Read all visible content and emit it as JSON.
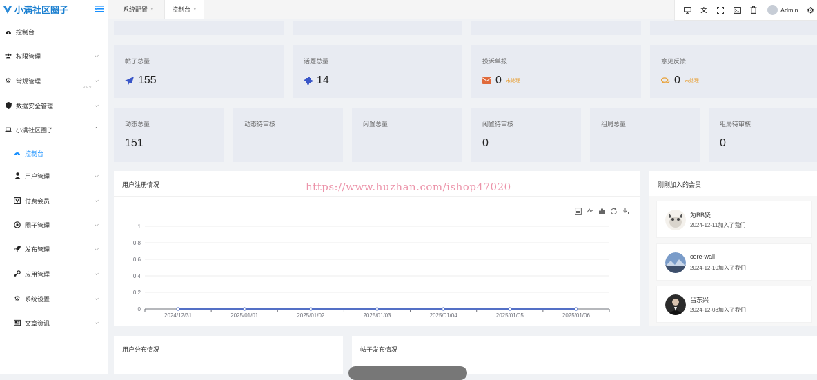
{
  "brand": {
    "title": "小满社区圈子"
  },
  "sidebar": {
    "items": [
      {
        "label": "控制台",
        "icon": "dashboard-icon"
      },
      {
        "label": "权限管理",
        "icon": "users-icon"
      },
      {
        "label": "常规管理",
        "icon": "gears-icon"
      },
      {
        "label": "数据安全管理",
        "icon": "shield-icon"
      },
      {
        "label": "小满社区圈子",
        "icon": "laptop-icon"
      },
      {
        "label": "控制台",
        "icon": "dashboard-icon"
      },
      {
        "label": "用户管理",
        "icon": "user-icon"
      },
      {
        "label": "付费会员",
        "icon": "vip-card-icon"
      },
      {
        "label": "圈子管理",
        "icon": "circle-icon"
      },
      {
        "label": "发布管理",
        "icon": "rocket-icon"
      },
      {
        "label": "应用管理",
        "icon": "steam-icon"
      },
      {
        "label": "系统设置",
        "icon": "gears-icon"
      },
      {
        "label": "文章资讯",
        "icon": "newspaper-icon"
      }
    ]
  },
  "tabs": [
    {
      "label": "系统配置"
    },
    {
      "label": "控制台"
    }
  ],
  "toolbar": {
    "user": "Admin"
  },
  "stats_row1": [
    {
      "title": "帖子总量",
      "value": "155",
      "icon": "paper-plane-icon",
      "color": "#3a56c8"
    },
    {
      "title": "话题总量",
      "value": "14",
      "icon": "puzzle-icon",
      "color": "#3a56c8"
    },
    {
      "title": "投诉单报",
      "value": "0",
      "icon": "envelope-icon",
      "color": "#e06a3b",
      "badge": "未处理"
    },
    {
      "title": "意见反馈",
      "value": "0",
      "icon": "comments-icon",
      "color": "#e8a23a",
      "badge": "未处理"
    }
  ],
  "stats_row2": [
    {
      "title": "动态总量",
      "value": "151"
    },
    {
      "title": "动态待审核",
      "value": ""
    },
    {
      "title": "闲置总量",
      "value": ""
    },
    {
      "title": "闲置待审核",
      "value": "0"
    },
    {
      "title": "组局总量",
      "value": ""
    },
    {
      "title": "组局待审核",
      "value": "0"
    }
  ],
  "register_panel": {
    "title": "用户注册情况"
  },
  "watermark": "https://www.huzhan.com/ishop47020",
  "members_panel": {
    "title": "刚刚加入的会员"
  },
  "members": [
    {
      "name": "为BB煲",
      "joined": "2024-12-11加入了我们"
    },
    {
      "name": "core-wall",
      "joined": "2024-12-10加入了我们"
    },
    {
      "name": "吕东兴",
      "joined": "2024-12-08加入了我们"
    }
  ],
  "distribution_panel": {
    "title": "用户分布情况"
  },
  "posts_panel": {
    "title": "帖子发布情况"
  },
  "chart_data": {
    "type": "line",
    "x": [
      "2024/12/31",
      "2025/01/01",
      "2025/01/02",
      "2025/01/03",
      "2025/01/04",
      "2025/01/05",
      "2025/01/06"
    ],
    "series": [
      {
        "values": [
          0,
          0,
          0,
          0,
          0,
          0,
          0
        ]
      }
    ],
    "yticks": [
      "0",
      "0.2",
      "0.4",
      "0.6",
      "0.8",
      "1"
    ],
    "ylim": [
      0,
      1
    ],
    "grid": true,
    "colors": {
      "line": "#5470c6",
      "grid": "#eeeeee",
      "axis": "#6e7079"
    }
  }
}
